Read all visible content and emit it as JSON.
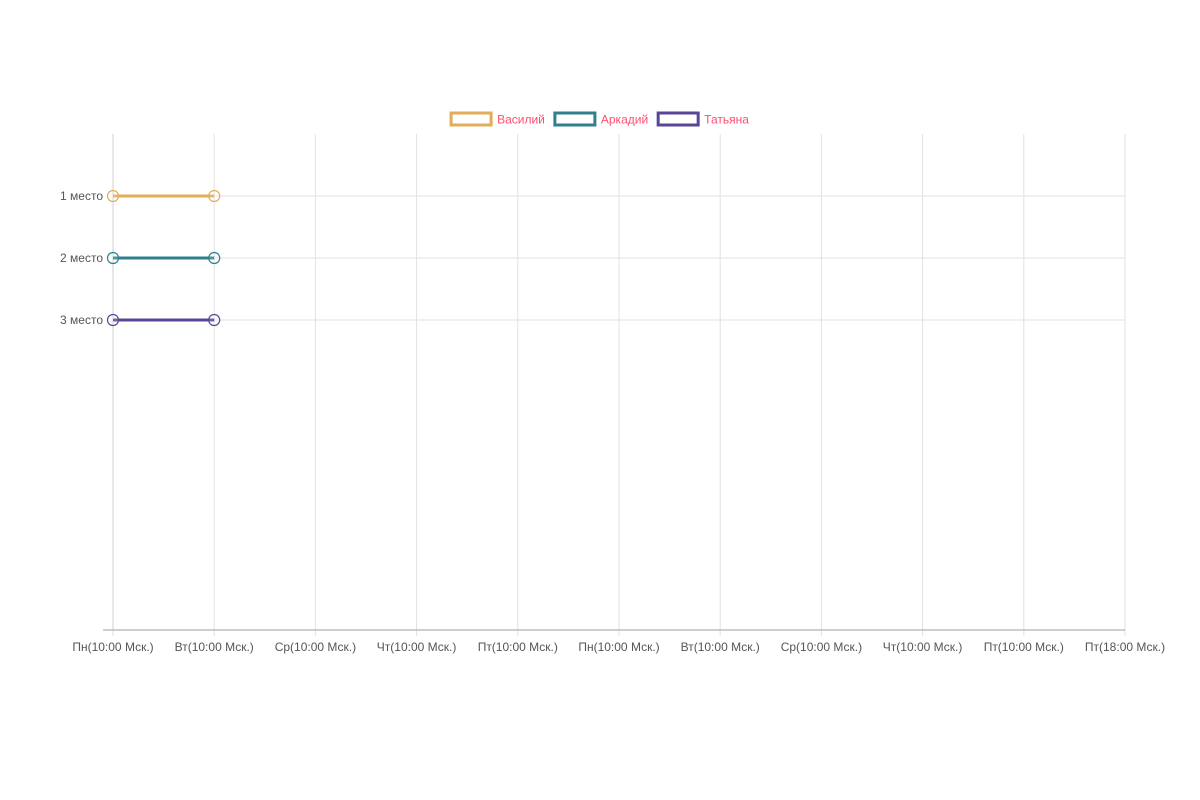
{
  "chart_data": {
    "type": "line",
    "title": "",
    "xlabel": "",
    "ylabel": "",
    "categories": [
      "Пн(10:00 Мск.)",
      "Вт(10:00 Мск.)",
      "Ср(10:00 Мск.)",
      "Чт(10:00 Мск.)",
      "Пт(10:00 Мск.)",
      "Пн(10:00 Мск.)",
      "Вт(10:00 Мск.)",
      "Ср(10:00 Мск.)",
      "Чт(10:00 Мск.)",
      "Пт(10:00 Мск.)",
      "Пт(18:00 Мск.)"
    ],
    "y_categories": [
      "1 место",
      "2 место",
      "3 место"
    ],
    "y_range": [
      0,
      8
    ],
    "y_reversed": true,
    "grid": true,
    "legend_position": "top-center",
    "series": [
      {
        "name": "Василий",
        "color": "#e3ac5a",
        "values": [
          1,
          1
        ]
      },
      {
        "name": "Аркадий",
        "color": "#2f7f8c",
        "values": [
          2,
          2
        ]
      },
      {
        "name": "Татьяна",
        "color": "#5a4596",
        "values": [
          3,
          3
        ]
      }
    ]
  }
}
